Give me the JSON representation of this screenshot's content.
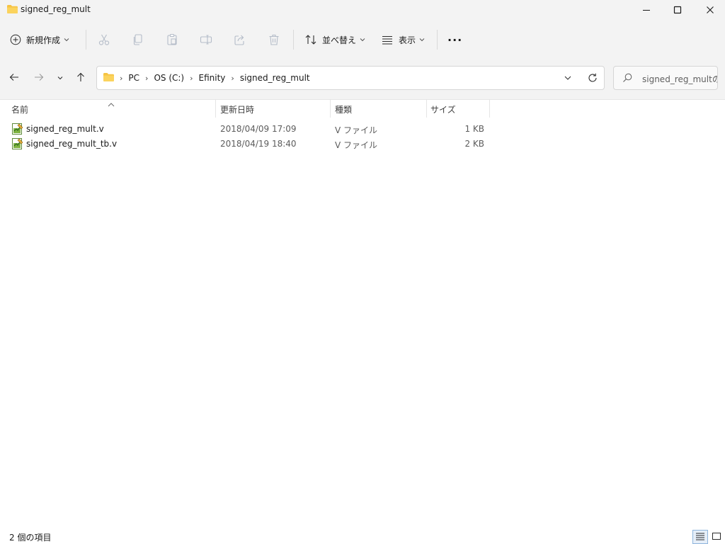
{
  "window": {
    "title": "signed_reg_mult"
  },
  "toolbar": {
    "new_label": "新規作成",
    "sort_label": "並べ替え",
    "view_label": "表示",
    "more_label": "···"
  },
  "address": {
    "crumbs": [
      "PC",
      "OS (C:)",
      "Efinity",
      "signed_reg_mult"
    ]
  },
  "search": {
    "placeholder": "signed_reg_multの..."
  },
  "columns": {
    "name": "名前",
    "modified": "更新日時",
    "type": "種類",
    "size": "サイズ"
  },
  "files": [
    {
      "name": "signed_reg_mult.v",
      "modified": "2018/04/09 17:09",
      "type": "V ファイル",
      "size": "1 KB"
    },
    {
      "name": "signed_reg_mult_tb.v",
      "modified": "2018/04/19 18:40",
      "type": "V ファイル",
      "size": "2 KB"
    }
  ],
  "status": {
    "count_text": "2 個の項目"
  },
  "icons": {
    "title": "folder-icon",
    "new": "plus-circle-icon",
    "cut": "scissors-icon",
    "copy": "copy-icon",
    "paste": "paste-icon",
    "rename": "rename-icon",
    "share": "share-icon",
    "delete": "trash-icon",
    "sort": "sort-icon",
    "view": "list-view-icon",
    "file": "verilog-file-icon"
  },
  "colors": {
    "chrome": "#f3f3f3",
    "folder": "#f6c342",
    "disabled_icon": "#b4bcc8",
    "selected_view": "#e5eef8"
  }
}
